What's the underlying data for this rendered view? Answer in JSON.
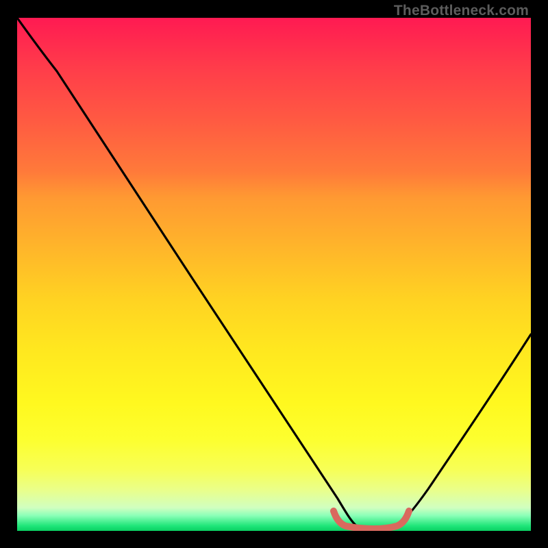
{
  "watermark": {
    "text": "TheBottleneck.com"
  },
  "chart_data": {
    "type": "line",
    "title": "",
    "xlabel": "",
    "ylabel": "",
    "xlim": [
      0,
      100
    ],
    "ylim": [
      0,
      100
    ],
    "grid": false,
    "legend": false,
    "series": [
      {
        "name": "bottleneck-curve",
        "color": "#000000",
        "x": [
          0,
          5,
          10,
          15,
          20,
          25,
          30,
          35,
          40,
          45,
          50,
          55,
          60,
          62,
          66,
          70,
          74,
          76,
          80,
          85,
          90,
          95,
          100
        ],
        "y": [
          100,
          96,
          90,
          83,
          76,
          69,
          62,
          55,
          48,
          40,
          32,
          23,
          12,
          7,
          1,
          0,
          0,
          1,
          7,
          14,
          22,
          30,
          39
        ]
      },
      {
        "name": "optimal-range-marker",
        "color": "#d9695e",
        "x": [
          62,
          64,
          66,
          68,
          70,
          72,
          74,
          76
        ],
        "y": [
          3.0,
          1.0,
          0.5,
          0.3,
          0.3,
          0.5,
          1.0,
          3.0
        ]
      }
    ],
    "gradient_stops": [
      {
        "pos": 0,
        "color": "#ff1a52"
      },
      {
        "pos": 50,
        "color": "#ffd322"
      },
      {
        "pos": 90,
        "color": "#fcff3c"
      },
      {
        "pos": 100,
        "color": "#09d062"
      }
    ]
  }
}
